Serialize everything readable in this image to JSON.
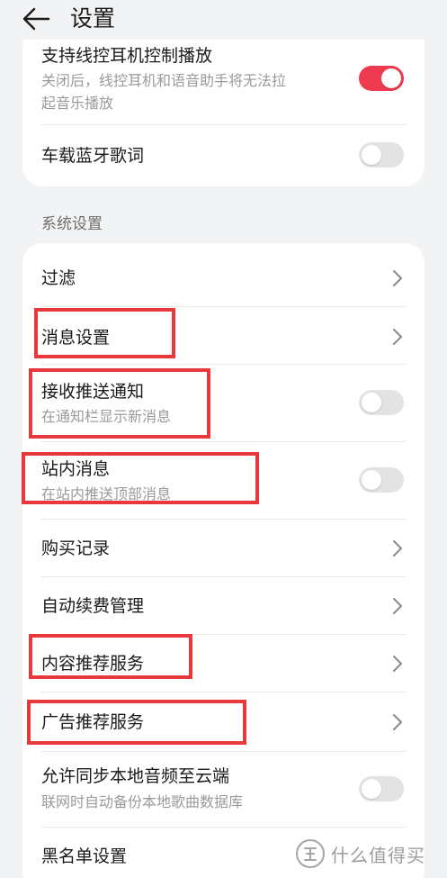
{
  "header": {
    "title": "设置"
  },
  "top_card": {
    "items": [
      {
        "title": "支持线控耳机控制播放",
        "subtitle": "关闭后，线控耳机和语音助手将无法拉起音乐播放",
        "subtitle_line1": "关闭后，线控耳机和语音助手将无法拉",
        "subtitle_line2": "起音乐播放",
        "toggle": true
      },
      {
        "title": "车载蓝牙歌词",
        "toggle": false
      }
    ]
  },
  "section": {
    "label": "系统设置"
  },
  "system_items": [
    {
      "title": "过滤",
      "type": "nav"
    },
    {
      "title": "消息设置",
      "type": "nav"
    },
    {
      "title": "接收推送通知",
      "subtitle": "在通知栏显示新消息",
      "type": "toggle",
      "on": false
    },
    {
      "title": "站内消息",
      "subtitle": "在站内推送顶部消息",
      "type": "toggle",
      "on": false
    },
    {
      "title": "购买记录",
      "type": "nav"
    },
    {
      "title": "自动续费管理",
      "type": "nav"
    },
    {
      "title": "内容推荐服务",
      "type": "nav"
    },
    {
      "title": "广告推荐服务",
      "type": "nav"
    },
    {
      "title": "允许同步本地音频至云端",
      "subtitle": "联网时自动备份本地歌曲数据库",
      "type": "toggle",
      "on": false
    },
    {
      "title": "黑名单设置",
      "type": "nav"
    }
  ],
  "watermark": {
    "text": "什么值得买",
    "logo": "zhi-logo-icon"
  },
  "colors": {
    "toggle_on": "#ee3b4f",
    "toggle_off": "#e3e3e3",
    "highlight": "#e8383b",
    "background": "#f1f3f5"
  }
}
